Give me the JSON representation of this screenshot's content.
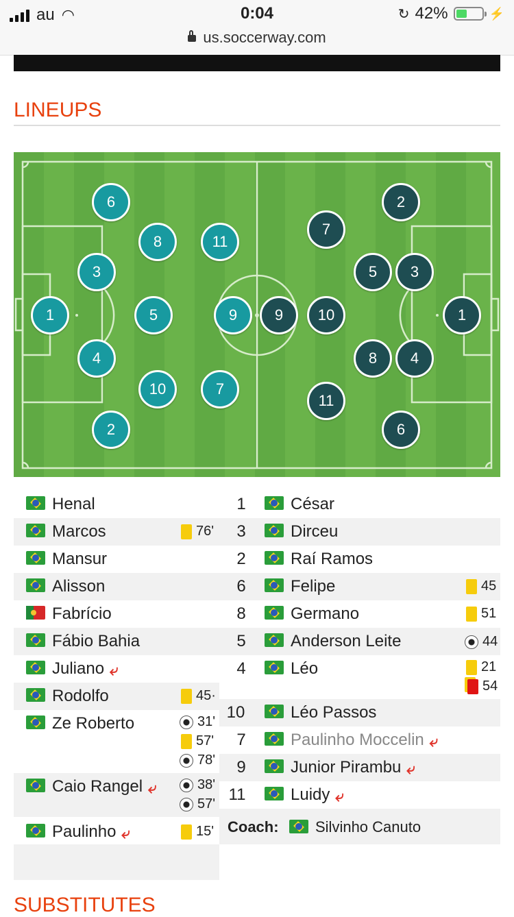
{
  "status_bar": {
    "carrier": "au",
    "time": "0:04",
    "battery": "42%",
    "battery_level": 0.42,
    "url": "us.soccerway.com"
  },
  "sections": {
    "lineups_title": "LINEUPS",
    "substitutes_title": "SUBSTITUTES"
  },
  "colors": {
    "accent": "#e8410e",
    "home_marker": "#189aa0",
    "away_marker": "#1e4d52",
    "pitch_light": "#6ab34a",
    "pitch_dark": "#5ea842"
  },
  "pitch": {
    "home_players": [
      "1",
      "3",
      "4",
      "5",
      "6",
      "8",
      "10",
      "2",
      "11",
      "9",
      "7"
    ],
    "away_players": [
      "2",
      "7",
      "5",
      "3",
      "9",
      "10",
      "1",
      "8",
      "4",
      "11",
      "6"
    ]
  },
  "home_lineup": [
    {
      "name": "Henal",
      "flag": "brazil-flag",
      "subbed": false,
      "events": []
    },
    {
      "name": "Marcos",
      "flag": "brazil-flag",
      "subbed": false,
      "events": [
        {
          "type": "yellow-card",
          "minute": "76'"
        }
      ]
    },
    {
      "name": "Mansur",
      "flag": "brazil-flag",
      "subbed": false,
      "events": []
    },
    {
      "name": "Alisson",
      "flag": "brazil-flag",
      "subbed": false,
      "events": []
    },
    {
      "name": "Fabrício",
      "flag": "portugal-flag",
      "subbed": false,
      "events": []
    },
    {
      "name": "Fábio Bahia",
      "flag": "brazil-flag",
      "subbed": false,
      "events": []
    },
    {
      "name": "Juliano",
      "flag": "brazil-flag",
      "subbed": true,
      "events": []
    },
    {
      "name": "Rodolfo",
      "flag": "brazil-flag",
      "subbed": false,
      "events": [
        {
          "type": "yellow-card",
          "minute": "45·"
        }
      ]
    },
    {
      "name": "Ze Roberto",
      "flag": "brazil-flag",
      "subbed": false,
      "events": [
        {
          "type": "goal",
          "minute": "31'"
        },
        {
          "type": "yellow-card",
          "minute": "57'"
        },
        {
          "type": "goal",
          "minute": "78'"
        }
      ]
    },
    {
      "name": "Caio Rangel",
      "flag": "brazil-flag",
      "subbed": true,
      "events": [
        {
          "type": "goal",
          "minute": "38'"
        },
        {
          "type": "goal",
          "minute": "57'"
        }
      ]
    },
    {
      "name": "Paulinho",
      "flag": "brazil-flag",
      "subbed": true,
      "events": [
        {
          "type": "yellow-card",
          "minute": "15'"
        }
      ]
    }
  ],
  "away_lineup": [
    {
      "number": "1",
      "name": "César",
      "flag": "brazil-flag",
      "subbed": false,
      "events": []
    },
    {
      "number": "3",
      "name": "Dirceu",
      "flag": "brazil-flag",
      "subbed": false,
      "events": []
    },
    {
      "number": "2",
      "name": "Raí Ramos",
      "flag": "brazil-flag",
      "subbed": false,
      "events": []
    },
    {
      "number": "6",
      "name": "Felipe",
      "flag": "brazil-flag",
      "subbed": false,
      "events": [
        {
          "type": "yellow-card",
          "minute": "45"
        }
      ]
    },
    {
      "number": "8",
      "name": "Germano",
      "flag": "brazil-flag",
      "subbed": false,
      "events": [
        {
          "type": "yellow-card",
          "minute": "51"
        }
      ]
    },
    {
      "number": "5",
      "name": "Anderson Leite",
      "flag": "brazil-flag",
      "subbed": false,
      "events": [
        {
          "type": "goal",
          "minute": "44"
        }
      ]
    },
    {
      "number": "4",
      "name": "Léo",
      "flag": "brazil-flag",
      "subbed": false,
      "events": [
        {
          "type": "yellow-card",
          "minute": "21"
        },
        {
          "type": "red-card",
          "minute": "54"
        }
      ]
    },
    {
      "number": "10",
      "name": "Léo Passos",
      "flag": "brazil-flag",
      "subbed": false,
      "events": []
    },
    {
      "number": "7",
      "name": "Paulinho Moccelin",
      "flag": "brazil-flag",
      "subbed": true,
      "muted": true,
      "events": []
    },
    {
      "number": "9",
      "name": "Junior Pirambu",
      "flag": "brazil-flag",
      "subbed": true,
      "events": []
    },
    {
      "number": "11",
      "name": "Luidy",
      "flag": "brazil-flag",
      "subbed": true,
      "events": []
    }
  ],
  "coach": {
    "label": "Coach:",
    "name": "Silvinho Canuto"
  }
}
